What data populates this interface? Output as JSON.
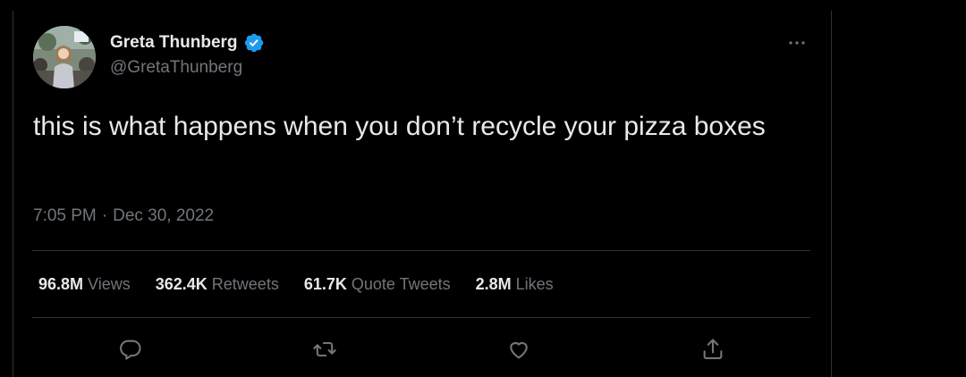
{
  "tweet": {
    "author": {
      "display_name": "Greta Thunberg",
      "handle": "@GretaThunberg",
      "verified": true
    },
    "text": "this is what happens when you don’t recycle your pizza boxes",
    "time": "7:05 PM",
    "separator": "·",
    "date": "Dec 30, 2022",
    "stats": {
      "views": {
        "value": "96.8M",
        "label": "Views"
      },
      "retweets": {
        "value": "362.4K",
        "label": "Retweets"
      },
      "quote_tweets": {
        "value": "61.7K",
        "label": "Quote Tweets"
      },
      "likes": {
        "value": "2.8M",
        "label": "Likes"
      }
    },
    "more_icon": "more-horizontal-icon",
    "actions": [
      "reply-icon",
      "retweet-icon",
      "like-icon",
      "share-icon"
    ]
  },
  "colors": {
    "background": "#000000",
    "primary_text": "#e7e9ea",
    "secondary_text": "#71767b",
    "border": "#2f3336",
    "verified_blue": "#1d9bf0"
  }
}
